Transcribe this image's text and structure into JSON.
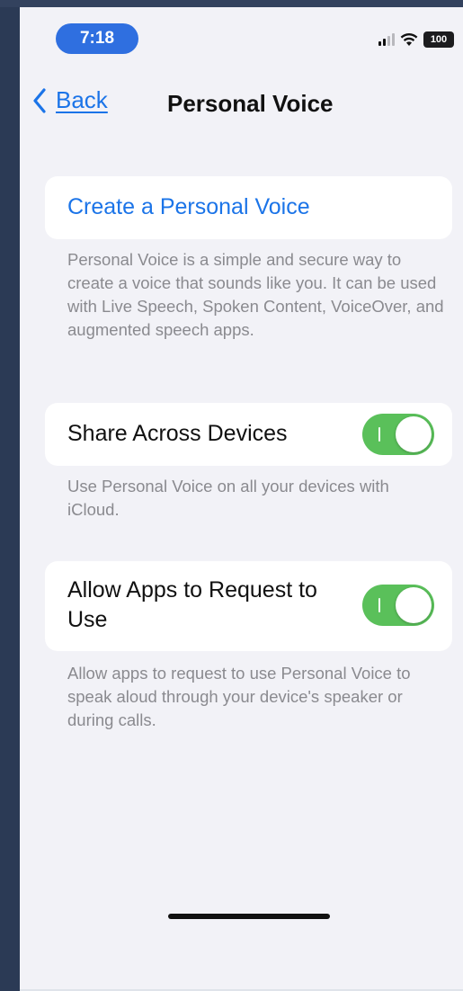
{
  "status_bar": {
    "time": "7:18",
    "battery": "100",
    "icons": [
      "signal-icon",
      "wifi-icon",
      "battery-icon"
    ]
  },
  "nav": {
    "back_label": "Back",
    "title": "Personal Voice"
  },
  "create": {
    "label": "Create a Personal Voice",
    "footnote": "Personal Voice is a simple and secure way to create a voice that sounds like you. It can be used with Live Speech, Spoken Content, VoiceOver, and augmented speech apps."
  },
  "share": {
    "label": "Share Across Devices",
    "on": true,
    "footnote": "Use Personal Voice on all your devices with iCloud."
  },
  "allow": {
    "label": "Allow Apps to Request to Use",
    "on": true,
    "footnote": "Allow apps to request to use Personal Voice to speak aloud through your device's speaker or during calls."
  },
  "colors": {
    "accent": "#1b74e8",
    "toggle_on": "#5ac05a",
    "background": "#f2f2f7",
    "footnote": "#8a8a8f"
  }
}
